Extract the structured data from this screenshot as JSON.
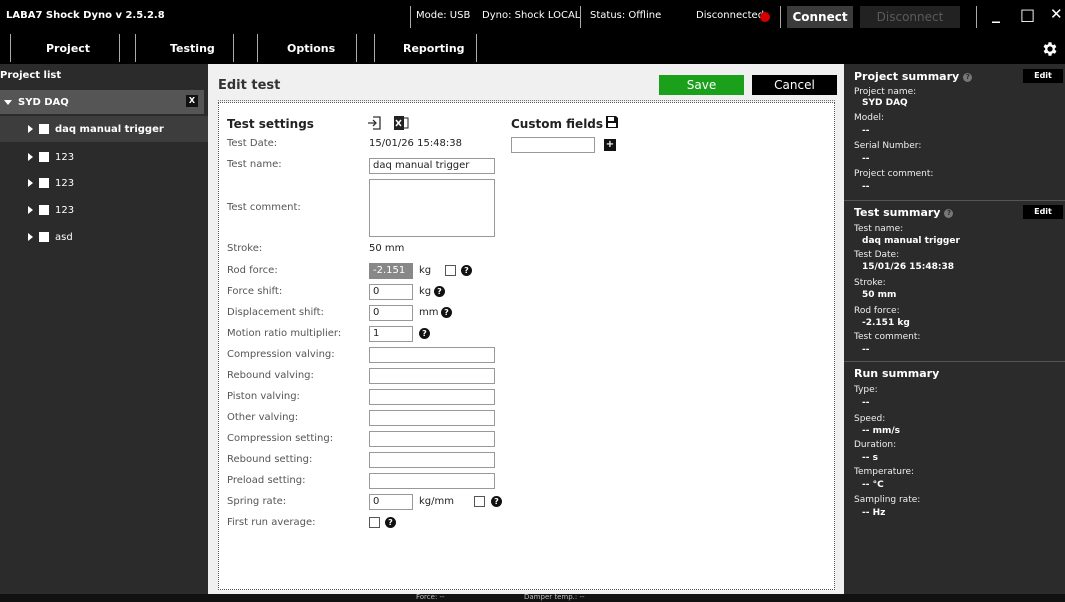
{
  "titlebar": {
    "app_title": "LABA7 Shock Dyno v 2.5.2.8",
    "mode": "Mode: USB",
    "dyno": "Dyno: Shock LOCAL",
    "status": "Status: Offline",
    "conn_state": "Disconnected",
    "connect_label": "Connect",
    "disconnect_label": "Disconnect",
    "minimize": "_",
    "maximize": "□",
    "close": "✕"
  },
  "menu": {
    "project": "Project",
    "testing": "Testing",
    "options": "Options",
    "reporting": "Reporting"
  },
  "left": {
    "header": "Project list",
    "root": {
      "label": "SYD DAQ",
      "close": "X"
    },
    "items": [
      {
        "label": "daq manual trigger"
      },
      {
        "label": "123"
      },
      {
        "label": "123"
      },
      {
        "label": "123"
      },
      {
        "label": "asd"
      }
    ]
  },
  "center": {
    "title": "Edit test",
    "save_label": "Save",
    "cancel_label": "Cancel",
    "settings_title": "Test settings",
    "custom_title": "Custom fields",
    "fields": {
      "test_date_label": "Test Date:",
      "test_date_value": "15/01/26 15:48:38",
      "test_name_label": "Test name:",
      "test_name_value": "daq manual trigger",
      "test_comment_label": "Test comment:",
      "stroke_label": "Stroke:",
      "stroke_value": "50 mm",
      "rod_force_label": "Rod force:",
      "rod_force_value": "-2.151",
      "rod_force_unit": "kg",
      "force_shift_label": "Force shift:",
      "force_shift_value": "0",
      "force_shift_unit": "kg",
      "disp_shift_label": "Displacement shift:",
      "disp_shift_value": "0",
      "disp_shift_unit": "mm",
      "motion_label": "Motion ratio multiplier:",
      "motion_value": "1",
      "compression_valving_label": "Compression valving:",
      "rebound_valving_label": "Rebound valving:",
      "piston_valving_label": "Piston valving:",
      "other_valving_label": "Other valving:",
      "compression_setting_label": "Compression setting:",
      "rebound_setting_label": "Rebound setting:",
      "preload_setting_label": "Preload setting:",
      "spring_rate_label": "Spring rate:",
      "spring_rate_value": "0",
      "spring_rate_unit": "kg/mm",
      "first_run_label": "First run average:"
    }
  },
  "right": {
    "project_summary_title": "Project summary",
    "edit_label": "Edit",
    "project_name_label": "Project name:",
    "project_name_value": "SYD DAQ",
    "model_label": "Model:",
    "model_value": "--",
    "serial_label": "Serial Number:",
    "serial_value": "--",
    "project_comment_label": "Project comment:",
    "project_comment_value": "--",
    "test_summary_title": "Test summary",
    "ts_name_label": "Test name:",
    "ts_name_value": "daq manual trigger",
    "ts_date_label": "Test Date:",
    "ts_date_value": "15/01/26 15:48:38",
    "ts_stroke_label": "Stroke:",
    "ts_stroke_value": "50 mm",
    "ts_rod_label": "Rod force:",
    "ts_rod_value": "-2.151 kg",
    "ts_comment_label": "Test comment:",
    "ts_comment_value": "--",
    "run_summary_title": "Run summary",
    "type_label": "Type:",
    "type_value": "--",
    "speed_label": "Speed:",
    "speed_value": "-- mm/s",
    "duration_label": "Duration:",
    "duration_value": "-- s",
    "temp_label": "Temperature:",
    "temp_value": "-- °C",
    "sampling_label": "Sampling rate:",
    "sampling_value": "-- Hz"
  },
  "statusbar": {
    "force": "Force: --",
    "damper_temp": "Damper temp.: --"
  },
  "colors": {
    "save_green": "#1aa01a",
    "accent_red": "#d40000"
  }
}
